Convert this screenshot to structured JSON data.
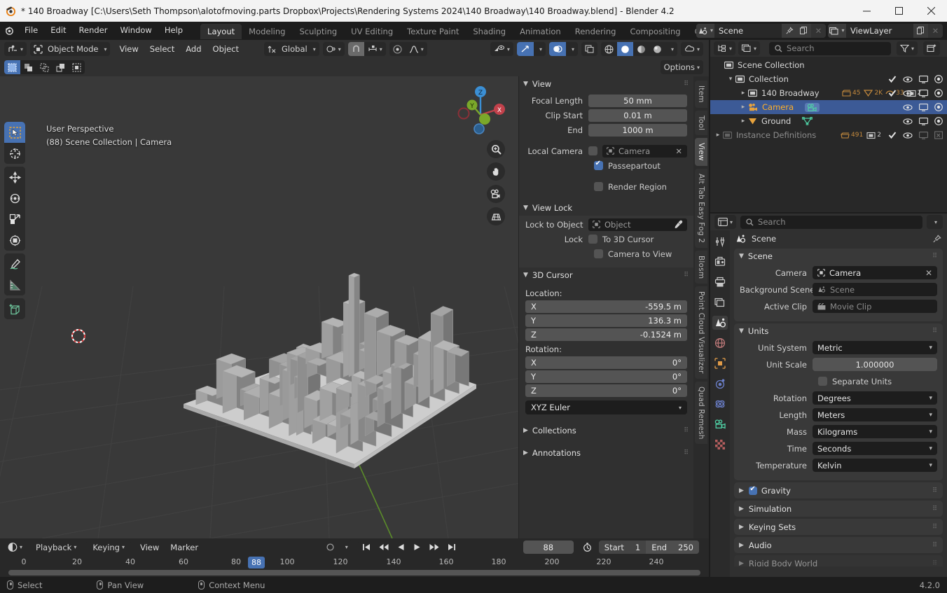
{
  "window": {
    "title": "* 140 Broadway [C:\\Users\\Seth Thompson\\alotofmoving.parts Dropbox\\Projects\\Rendering Systems 2024\\140 Broadway\\140 Broadway.blend] - Blender 4.2",
    "minimize": "─",
    "maximize": "□",
    "close": "✕"
  },
  "topbar": {
    "menus": [
      "File",
      "Edit",
      "Render",
      "Window",
      "Help"
    ],
    "workspaces": [
      "Layout",
      "Modeling",
      "Sculpting",
      "UV Editing",
      "Texture Paint",
      "Shading",
      "Animation",
      "Rendering",
      "Compositing",
      "Geometry No"
    ],
    "active_workspace": "Layout",
    "scene_name": "Scene",
    "viewlayer_name": "ViewLayer"
  },
  "viewport": {
    "header": {
      "mode": "Object Mode",
      "menus": [
        "View",
        "Select",
        "Add",
        "Object"
      ],
      "transform_orientation": "Global",
      "options_label": "Options"
    },
    "overlay_line1": "User Perspective",
    "overlay_line2": "(88) Scene Collection | Camera",
    "gizmo_axes": {
      "x": "X",
      "y": "Y",
      "z": "Z"
    },
    "tabs": [
      "Item",
      "Tool",
      "View",
      "Alt Tab Easy Fog 2",
      "Blosm",
      "Point Cloud Visualizer",
      "Quad Remesh"
    ],
    "active_tab": "View"
  },
  "npanel": {
    "view": {
      "title": "View",
      "focal_length_label": "Focal Length",
      "focal_length": "50 mm",
      "clip_start_label": "Clip Start",
      "clip_start": "0.01 m",
      "end_label": "End",
      "end": "1000 m",
      "local_camera_label": "Local Camera",
      "local_camera_value": "Camera",
      "passepartout_label": "Passepartout",
      "render_region_label": "Render Region"
    },
    "view_lock": {
      "title": "View Lock",
      "lock_to_object_label": "Lock to Object",
      "lock_to_object_value": "Object",
      "lock_label": "Lock",
      "to_3d_cursor_label": "To 3D Cursor",
      "camera_to_view_label": "Camera to View"
    },
    "cursor": {
      "title": "3D Cursor",
      "location_label": "Location:",
      "location": [
        {
          "axis": "X",
          "value": "-559.5 m"
        },
        {
          "axis": "Y",
          "value": "136.3 m"
        },
        {
          "axis": "Z",
          "value": "-0.1524 m"
        }
      ],
      "rotation_label": "Rotation:",
      "rotation": [
        {
          "axis": "X",
          "value": "0°"
        },
        {
          "axis": "Y",
          "value": "0°"
        },
        {
          "axis": "Z",
          "value": "0°"
        }
      ],
      "rotation_mode": "XYZ Euler"
    },
    "collections_title": "Collections",
    "annotations_title": "Annotations"
  },
  "outliner": {
    "search_placeholder": "Search",
    "rows": [
      {
        "name": "Scene Collection",
        "indent": 0,
        "twist": "",
        "icon": "collection-icon",
        "selected": false,
        "dim": false,
        "counts": [],
        "toggles": []
      },
      {
        "name": "Collection",
        "indent": 1,
        "twist": "▾",
        "icon": "collection-icon",
        "selected": false,
        "dim": false,
        "counts": [],
        "toggles": [
          "check",
          "eye",
          "screen",
          "camera"
        ]
      },
      {
        "name": "140 Broadway",
        "indent": 2,
        "twist": "▸",
        "icon": "collection-icon",
        "selected": false,
        "dim": false,
        "counts": [
          "45",
          "2K",
          "33",
          "2"
        ],
        "toggles": [
          "check",
          "eye",
          "screen",
          "camera"
        ]
      },
      {
        "name": "Camera",
        "indent": 2,
        "twist": "▸",
        "icon": "camera-icon",
        "selected": true,
        "dim": false,
        "counts": [],
        "toggles": [
          "eye",
          "screen",
          "camera"
        ]
      },
      {
        "name": "Ground",
        "indent": 2,
        "twist": "▸",
        "icon": "mesh-icon",
        "selected": false,
        "dim": false,
        "counts": [],
        "toggles": [
          "eye",
          "screen",
          "camera"
        ]
      },
      {
        "name": "Instance Definitions",
        "indent": 0,
        "twist": "▸",
        "icon": "collection-icon",
        "selected": false,
        "dim": true,
        "counts": [
          "491",
          "2"
        ],
        "toggles": [
          "check",
          "eye",
          "screen-off",
          "camera-off"
        ]
      }
    ]
  },
  "properties": {
    "search_placeholder": "Search",
    "breadcrumb": "Scene",
    "tabs": [
      "tool-icon",
      "render-icon",
      "output-icon",
      "viewlayer-icon",
      "scene-icon",
      "world-icon",
      "object-icon",
      "modifier-icon",
      "physics-icon",
      "data-camera-icon",
      "texture-icon"
    ],
    "active_tab": "scene-icon",
    "scene_panel": {
      "title": "Scene",
      "camera_label": "Camera",
      "camera_value": "Camera",
      "background_scene_label": "Background Scene",
      "background_scene_value": "Scene",
      "active_clip_label": "Active Clip",
      "active_clip_value": "Movie Clip"
    },
    "units_panel": {
      "title": "Units",
      "unit_system_label": "Unit System",
      "unit_system_value": "Metric",
      "unit_scale_label": "Unit Scale",
      "unit_scale_value": "1.000000",
      "separate_units_label": "Separate Units",
      "rotation_label": "Rotation",
      "rotation_value": "Degrees",
      "length_label": "Length",
      "length_value": "Meters",
      "mass_label": "Mass",
      "mass_value": "Kilograms",
      "time_label": "Time",
      "time_value": "Seconds",
      "temperature_label": "Temperature",
      "temperature_value": "Kelvin"
    },
    "closed_panels": [
      "Gravity",
      "Simulation",
      "Keying Sets",
      "Audio",
      "Rigid Body World"
    ]
  },
  "timeline": {
    "menus": [
      "Playback",
      "Keying",
      "View",
      "Marker"
    ],
    "current_frame": "88",
    "start_label": "Start",
    "start_value": "1",
    "end_label": "End",
    "end_value": "250",
    "ticks": [
      "0",
      "20",
      "40",
      "60",
      "80",
      "100",
      "120",
      "140",
      "160",
      "180",
      "200",
      "220",
      "240"
    ]
  },
  "statusbar": {
    "items": [
      {
        "label": "Select",
        "mouse": "left"
      },
      {
        "label": "Pan View",
        "mouse": "middle"
      },
      {
        "label": "Context Menu",
        "mouse": "right"
      }
    ],
    "version": "4.2.0"
  },
  "colors": {
    "accent_blue": "#4772b3",
    "selected_orange": "#ffaf29",
    "outliner_select_bg": "#3c5a96",
    "panel_bg": "#303030",
    "viewport_bg": "#393939"
  }
}
